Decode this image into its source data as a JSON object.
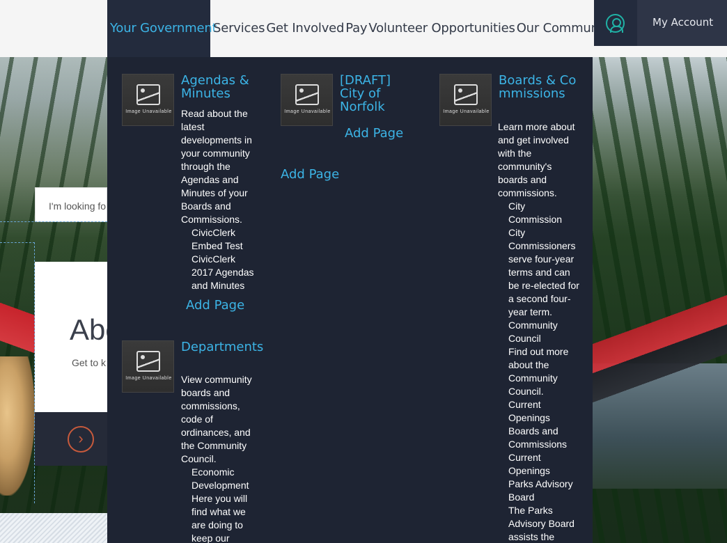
{
  "nav": {
    "items": [
      {
        "label": "Your Government",
        "active": true
      },
      {
        "label": "Services"
      },
      {
        "label": "Get Involved"
      },
      {
        "label": "Pay"
      },
      {
        "label": "Volunteer Opportunities"
      },
      {
        "label": "Our Community"
      }
    ],
    "account_icon": "user-circle-icon",
    "my_account": "My Account"
  },
  "background": {
    "search_placeholder": "I'm looking fo",
    "about_title": "Abo",
    "about_sub": "Get to k",
    "arrow_icon": "chevron-right-circle-icon"
  },
  "menu": {
    "image_caption": "Image Unavailable",
    "add_page": "Add Page",
    "col1": {
      "agendas": {
        "title": "Agendas & Minutes",
        "desc": "Read about the latest developments in your community through the Agendas and Minutes of your Boards and Commissions.",
        "links": [
          "CivicClerk Embed Test",
          "CivicClerk 2017 Agendas and Minutes"
        ]
      },
      "departments": {
        "title": "Departments",
        "desc": "View community boards and commissions, code of ordinances, and the Community Council.",
        "links": [
          "Economic Development",
          "Here you will find what we are doing to keep our"
        ]
      }
    },
    "col2": {
      "draft": {
        "title": "[DRAFT] City of Norfolk"
      }
    },
    "col3": {
      "boards": {
        "title": "Boards & Commissions",
        "desc": "Learn more about and get involved with the community's boards and commissions.",
        "links": [
          "City Commission",
          "City Commissioners serve four-year terms and can be re-elected for a second four-year term.",
          "Community Council",
          "Find out more about the Community Council.",
          "Current Openings",
          "Boards and Commissions Current Openings",
          "Parks Advisory Board",
          "The Parks Advisory Board assists the"
        ]
      }
    }
  },
  "colors": {
    "nav_active_bg": "#232b3d",
    "accent": "#3cb4e6",
    "menu_bg": "#1e2433"
  }
}
